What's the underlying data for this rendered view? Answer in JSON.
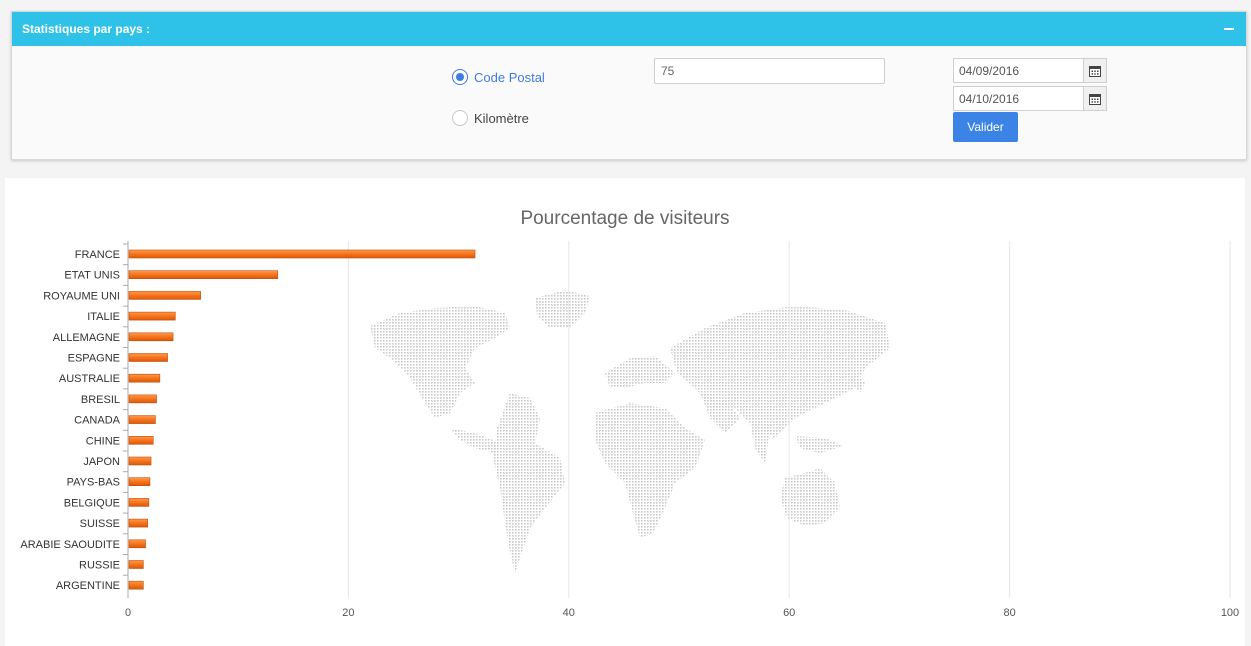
{
  "panel": {
    "title": "Statistiques par pays :"
  },
  "form": {
    "radio_code_postal": "Code Postal",
    "radio_kilometre": "Kilomètre",
    "code_value": "75",
    "date_start": "04/09/2016",
    "date_end": "04/10/2016",
    "submit_label": "Valider"
  },
  "colors": {
    "header": "#2ec2e8",
    "accent": "#3b84e6",
    "bar": "#f7731c"
  },
  "chart_data": {
    "type": "bar",
    "orientation": "horizontal",
    "title": "Pourcentage de visiteurs",
    "categories": [
      "FRANCE",
      "ETAT UNIS",
      "ROYAUME UNI",
      "ITALIE",
      "ALLEMAGNE",
      "ESPAGNE",
      "AUSTRALIE",
      "BRESIL",
      "CANADA",
      "CHINE",
      "JAPON",
      "PAYS-BAS",
      "BELGIQUE",
      "SUISSE",
      "ARABIE SAOUDITE",
      "RUSSIE",
      "ARGENTINE"
    ],
    "values": [
      31.4,
      13.5,
      6.5,
      4.2,
      4.0,
      3.5,
      2.8,
      2.5,
      2.4,
      2.2,
      2.0,
      1.9,
      1.8,
      1.7,
      1.5,
      1.3,
      1.3
    ],
    "xlim": [
      0,
      100
    ],
    "xticks": [
      0,
      20,
      40,
      60,
      80,
      100
    ],
    "grid": true
  }
}
